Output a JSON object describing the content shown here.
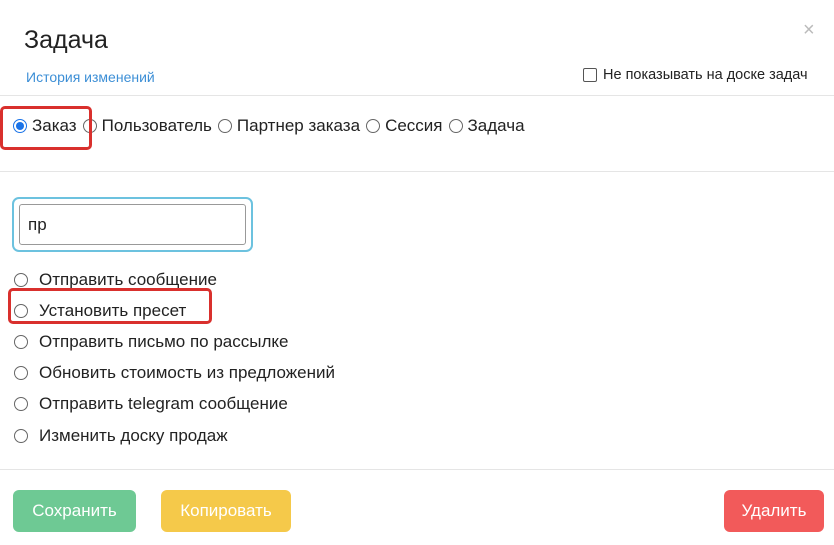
{
  "modal": {
    "title": "Задача",
    "close_glyph": "×",
    "history_link": "История изменений",
    "hide_label": "Не показывать на доске задач",
    "hide_checked": false
  },
  "entity_types": [
    {
      "label": "Заказ",
      "checked": true
    },
    {
      "label": "Пользователь",
      "checked": false
    },
    {
      "label": "Партнер заказа",
      "checked": false
    },
    {
      "label": "Сессия",
      "checked": false
    },
    {
      "label": "Задача",
      "checked": false
    }
  ],
  "search": {
    "value": "пр",
    "placeholder": ""
  },
  "actions": [
    {
      "label": "Отправить сообщение",
      "checked": false
    },
    {
      "label": "Установить пресет",
      "checked": false
    },
    {
      "label": "Отправить письмо по рассылке",
      "checked": false
    },
    {
      "label": "Обновить стоимость из предложений",
      "checked": false
    },
    {
      "label": "Отправить telegram сообщение",
      "checked": false
    },
    {
      "label": "Изменить доску продаж",
      "checked": false
    }
  ],
  "buttons": {
    "save": "Сохранить",
    "copy": "Копировать",
    "delete": "Удалить"
  },
  "colors": {
    "link": "#3d8fd6",
    "radio_checked": "#1a73e8",
    "highlight": "#d9302d",
    "input_focus": "#6cc2df",
    "save": "#6ec994",
    "copy": "#f5c94a",
    "delete": "#f25a5a"
  }
}
